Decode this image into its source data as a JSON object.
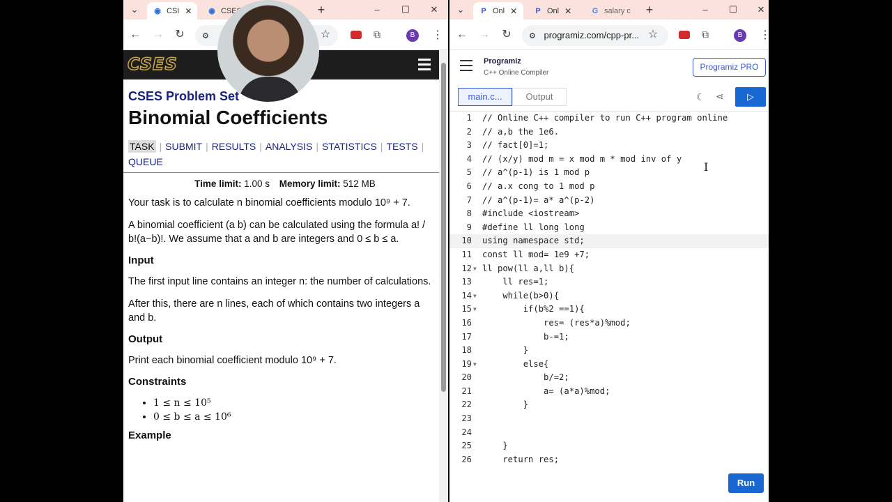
{
  "left_browser": {
    "tabs": [
      {
        "label": "CSI",
        "active": true
      },
      {
        "label": "CSES",
        "active": false
      }
    ],
    "omnibox": ""
  },
  "cses": {
    "set_title": "CSES Problem Set",
    "problem_title": "Binomial Coefficients",
    "nav": [
      "TASK",
      "SUBMIT",
      "RESULTS",
      "ANALYSIS",
      "STATISTICS",
      "TESTS",
      "QUEUE"
    ],
    "time_limit_label": "Time limit:",
    "time_limit": "1.00 s",
    "memory_limit_label": "Memory limit:",
    "memory_limit": "512 MB",
    "p1": "Your task is to calculate n binomial coefficients modulo 10⁹ + 7.",
    "p2": "A binomial coefficient (a b) can be calculated using the formula a! / b!(a−b)!. We assume that a and b are integers and 0 ≤ b ≤ a.",
    "input_heading": "Input",
    "input_p1": "The first input line contains an integer n: the number of calculations.",
    "input_p2": "After this, there are n lines, each of which contains two integers a and b.",
    "output_heading": "Output",
    "output_p": "Print each binomial coefficient modulo 10⁹ + 7.",
    "constraints_heading": "Constraints",
    "constraints": [
      "1 ≤ n ≤ 10⁵",
      "0 ≤ b ≤ a ≤ 10⁶"
    ],
    "example_heading": "Example"
  },
  "right_browser": {
    "tabs": [
      {
        "label": "Onl",
        "active": true
      },
      {
        "label": "Onl",
        "active": false
      },
      {
        "label": "salary c",
        "active": false
      }
    ],
    "omnibox": "programiz.com/cpp-pr..."
  },
  "programiz": {
    "logo": "Programiz",
    "subtitle": "C++ Online Compiler",
    "pro_button": "Programiz PRO",
    "file_tab": "main.c...",
    "output_tab": "Output",
    "run_button": "Run",
    "code_lines": [
      "// Online C++ compiler to run C++ program online",
      "// a,b the 1e6.",
      "// fact[0]=1;",
      "// (x/y) mod m = x mod m * mod inv of y",
      "// a^(p-1) is 1 mod p",
      "// a.x cong to 1 mod p",
      "// a^(p-1)= a* a^(p-2)",
      "#include <iostream>",
      "#define ll long long",
      "using namespace std;",
      "const ll mod= 1e9 +7;",
      "ll pow(ll a,ll b){",
      "    ll res=1;",
      "    while(b>0){",
      "        if(b%2 ==1){",
      "            res= (res*a)%mod;",
      "            b-=1;",
      "        }",
      "        else{",
      "            b/=2;",
      "            a= (a*a)%mod;",
      "        }",
      "",
      "",
      "    }",
      "    return res;"
    ]
  }
}
